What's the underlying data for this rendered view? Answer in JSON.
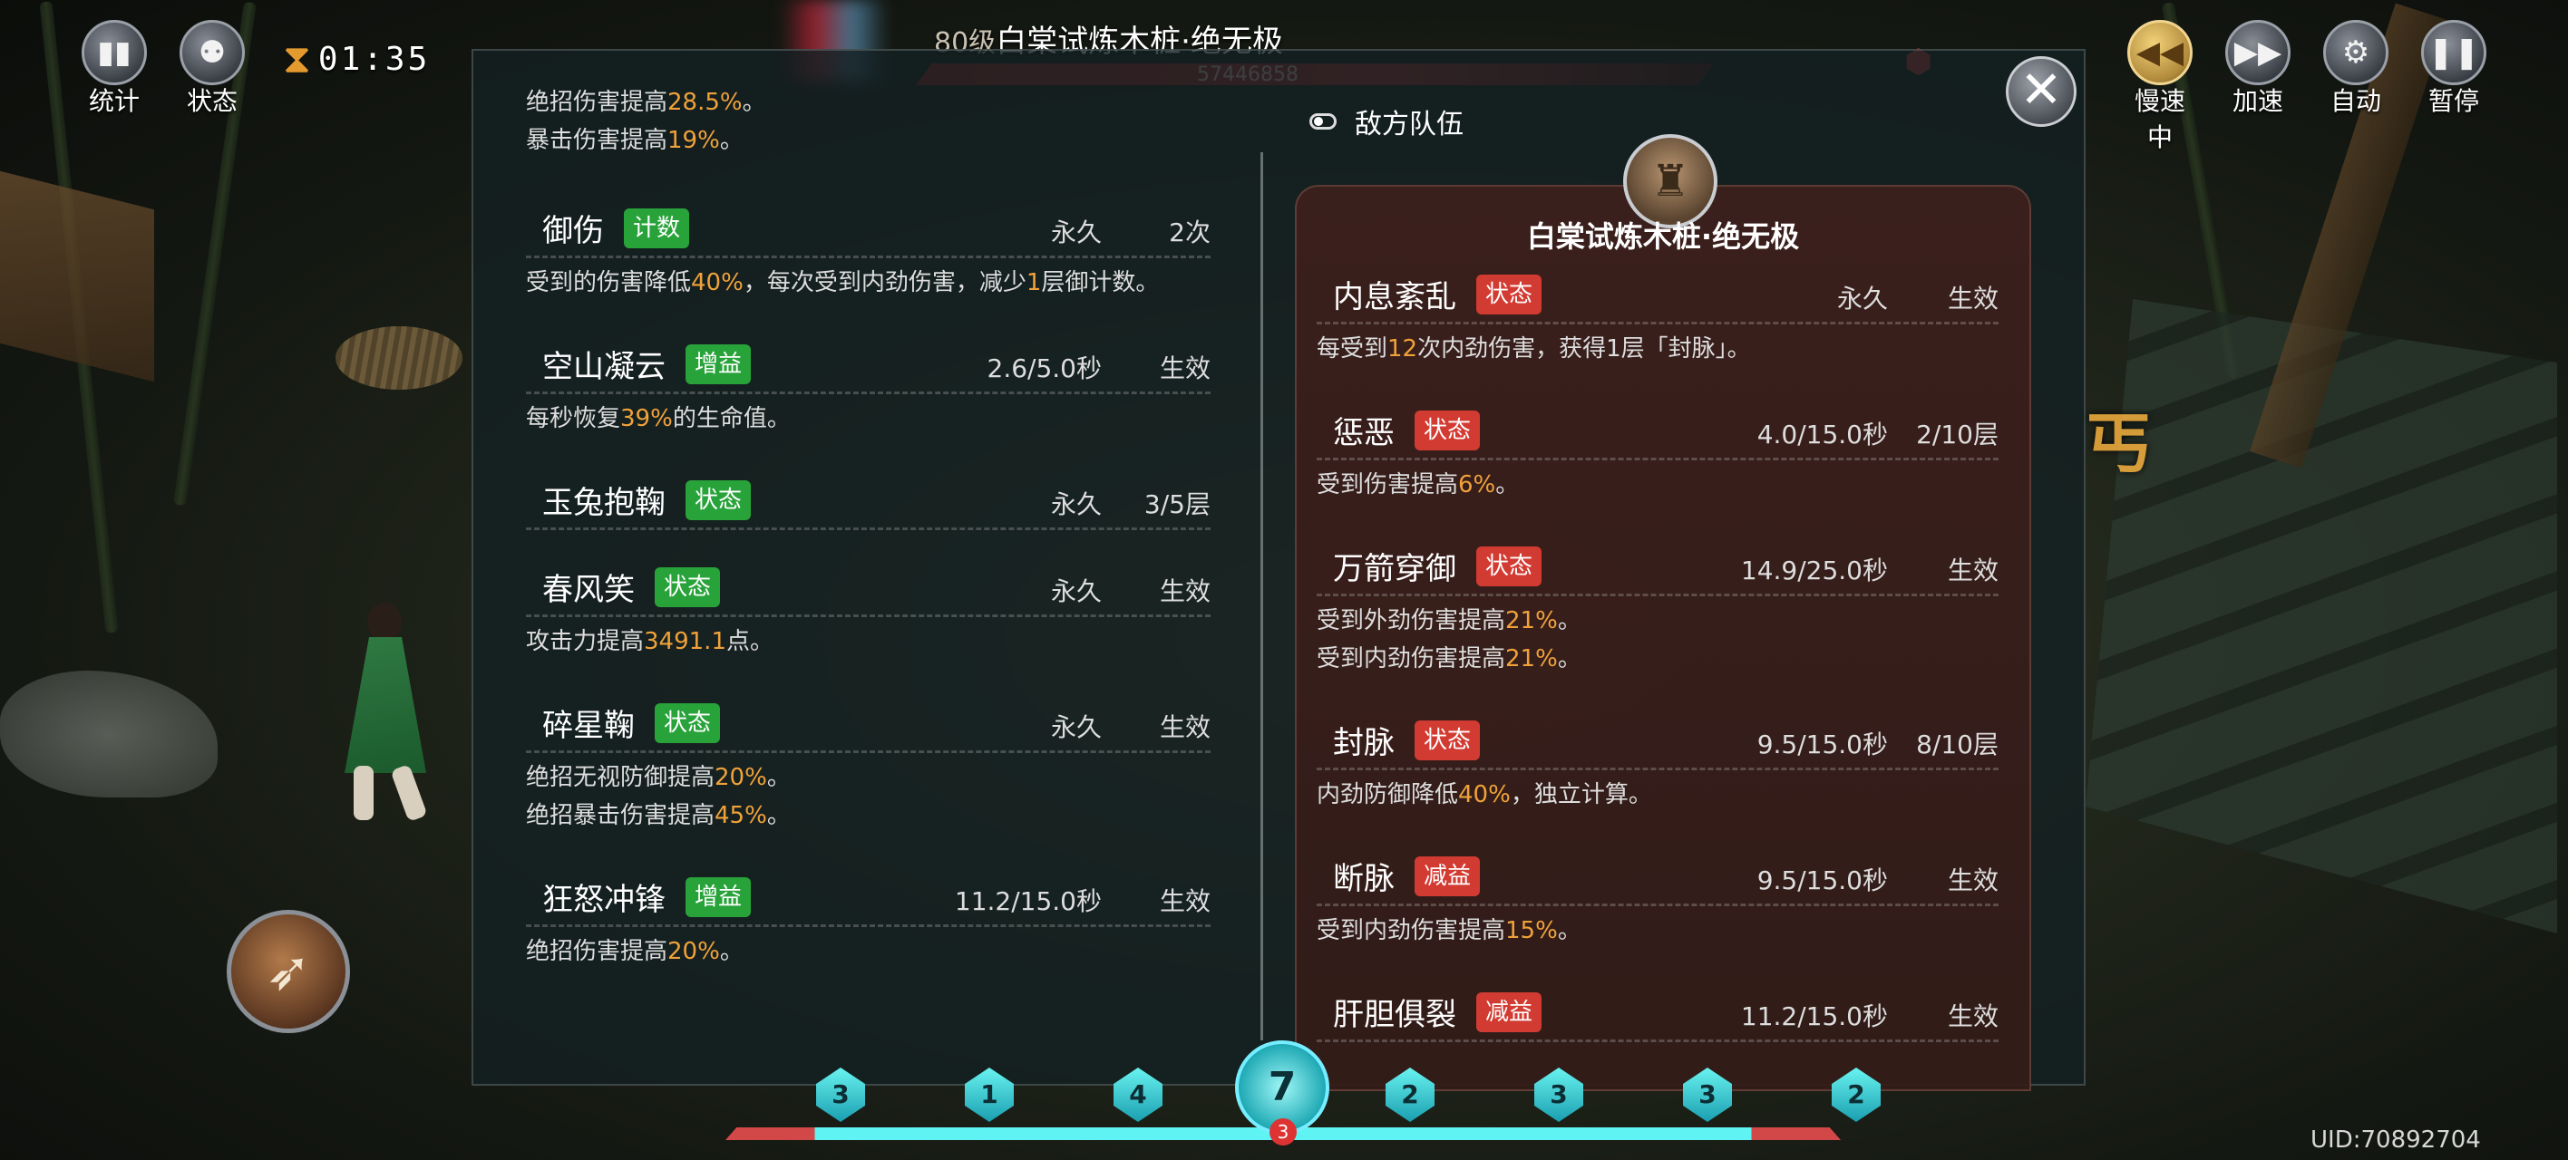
{
  "hud": {
    "stats_label": "统计",
    "status_label": "状态",
    "timer": "01:35",
    "slow_label": "慢速中",
    "speed_label": "加速",
    "auto_label": "自动",
    "pause_label": "暂停"
  },
  "boss": {
    "level": "80级",
    "name": "白棠试炼木桩·绝无极",
    "hp_value": "57446858"
  },
  "left_panel": {
    "top_desc_lines": [
      "绝招伤害提高{28.5%}。",
      "暴击伤害提高{19%}。"
    ],
    "buffs": [
      {
        "name": "御伤",
        "tag": "计数",
        "tag_color": "green",
        "duration": "永久",
        "effect": "2次",
        "desc": [
          "受到的伤害降低{40%}，每次受到内劲伤害，减少{1}层御计数。"
        ]
      },
      {
        "name": "空山凝云",
        "tag": "增益",
        "tag_color": "green",
        "duration": "2.6/5.0秒",
        "effect": "生效",
        "desc": [
          "每秒恢复{39%}的生命值。"
        ]
      },
      {
        "name": "玉兔抱鞠",
        "tag": "状态",
        "tag_color": "green",
        "duration": "永久",
        "effect": "3/5层",
        "desc": []
      },
      {
        "name": "春风笑",
        "tag": "状态",
        "tag_color": "green",
        "duration": "永久",
        "effect": "生效",
        "desc": [
          "攻击力提高{3491.1}点。"
        ]
      },
      {
        "name": "碎星鞠",
        "tag": "状态",
        "tag_color": "green",
        "duration": "永久",
        "effect": "生效",
        "desc": [
          "绝招无视防御提高{20%}。",
          "绝招暴击伤害提高{45%}。"
        ]
      },
      {
        "name": "狂怒冲锋",
        "tag": "增益",
        "tag_color": "green",
        "duration": "11.2/15.0秒",
        "effect": "生效",
        "desc": [
          "绝招伤害提高{20%}。"
        ]
      }
    ]
  },
  "right_panel": {
    "header": "敌方队伍",
    "enemy_name": "白棠试炼木桩·绝无极",
    "debuffs": [
      {
        "name": "内息紊乱",
        "tag": "状态",
        "tag_color": "red",
        "duration": "永久",
        "effect": "生效",
        "desc": [
          "每受到{12}次内劲伤害，获得1层「封脉」。"
        ]
      },
      {
        "name": "惩恶",
        "tag": "状态",
        "tag_color": "red",
        "duration": "4.0/15.0秒",
        "effect": "2/10层",
        "desc": [
          "受到伤害提高{6%}。"
        ]
      },
      {
        "name": "万箭穿御",
        "tag": "状态",
        "tag_color": "red",
        "duration": "14.9/25.0秒",
        "effect": "生效",
        "desc": [
          "受到外劲伤害提高{21%}。",
          "受到内劲伤害提高{21%}。"
        ]
      },
      {
        "name": "封脉",
        "tag": "状态",
        "tag_color": "red",
        "duration": "9.5/15.0秒",
        "effect": "8/10层",
        "desc": [
          "内劲防御降低{40%}，独立计算。"
        ]
      },
      {
        "name": "断脉",
        "tag": "减益",
        "tag_color": "red",
        "duration": "9.5/15.0秒",
        "effect": "生效",
        "desc": [
          "受到内劲伤害提高{15%}。"
        ]
      },
      {
        "name": "肝胆俱裂",
        "tag": "减益",
        "tag_color": "red",
        "duration": "11.2/15.0秒",
        "effect": "生效",
        "desc": []
      }
    ]
  },
  "skillbar": {
    "gems": [
      "3",
      "1",
      "4",
      "2",
      "3",
      "3",
      "2"
    ],
    "center": "7",
    "center_sub": "3"
  },
  "side_text": "丐",
  "uid": "UID:70892704",
  "colors": {
    "highlight": "#f0a23a",
    "buff_tag": "#28a33a",
    "debuff_tag": "#d23b32"
  }
}
